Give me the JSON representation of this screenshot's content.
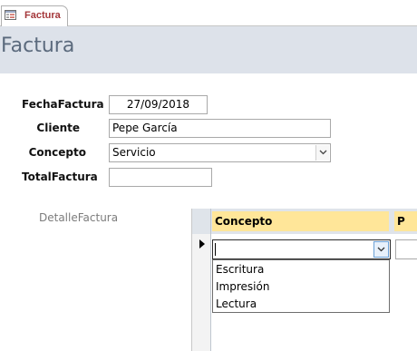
{
  "tab": {
    "label": "Factura",
    "icon": "form-icon"
  },
  "header": {
    "title": "Factura"
  },
  "form": {
    "fecha": {
      "label": "FechaFactura",
      "value": "27/09/2018"
    },
    "cliente": {
      "label": "Cliente",
      "value": "Pepe García"
    },
    "concepto": {
      "label": "Concepto",
      "value": "Servicio"
    },
    "total": {
      "label": "TotalFactura",
      "value": ""
    }
  },
  "subform": {
    "label": "DetalleFactura",
    "columns": [
      "Concepto",
      "P"
    ],
    "current_value": "",
    "options": [
      "Escritura",
      "Impresión",
      "Lectura"
    ]
  },
  "colors": {
    "tab_text": "#a4373a",
    "header_bg": "#dde2ea",
    "column_header_bg": "#ffe699"
  }
}
